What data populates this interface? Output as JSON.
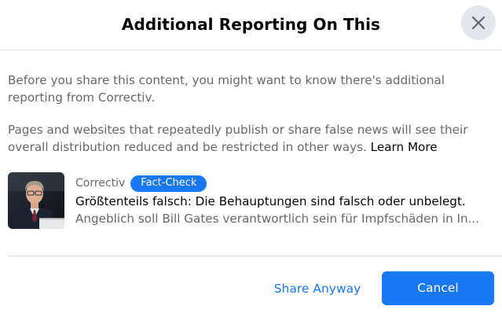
{
  "dialog": {
    "title": "Additional Reporting On This",
    "close_icon": "close-icon"
  },
  "body": {
    "paragraph1": "Before you share this content, you might want to know there's additional reporting from Correctiv.",
    "paragraph2": "Pages and websites that repeatedly publish or share false news will see their overall distribution reduced and be restricted in other ways.",
    "learn_more": "Learn More"
  },
  "article": {
    "publisher": "Correctiv",
    "badge": "Fact-Check",
    "headline": "Größtenteils falsch: Die Behauptungen sind falsch oder unbelegt.",
    "snippet": "Angeblich soll Bill Gates verantwortlich sein für Impfschäden in In...",
    "thumbnail_icon": "article-photo"
  },
  "footer": {
    "share_anyway": "Share Anyway",
    "cancel": "Cancel"
  },
  "colors": {
    "accent": "#1877f2",
    "secondary_text": "#65676b",
    "primary_text": "#050505",
    "divider": "#dadde1",
    "close_bg": "#e4e6eb"
  }
}
